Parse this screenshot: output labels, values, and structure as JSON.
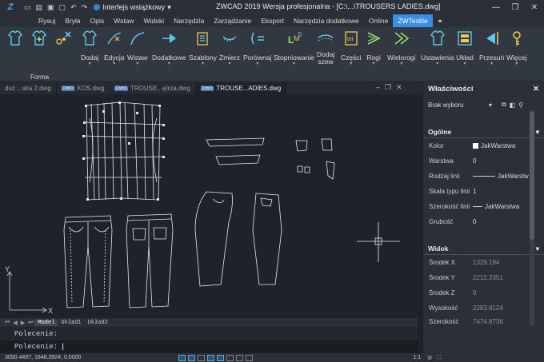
{
  "titlebar": {
    "logo": "Z",
    "workspace": "Interfejs wstążkowy",
    "title": "ZWCAD 2019 Wersja profesjonalna - [C:\\...\\TROUSERS LADIES.dwg]",
    "window_buttons": [
      "—",
      "❐",
      "✕"
    ]
  },
  "menu": {
    "items": [
      "Rysuj",
      "Bryła",
      "Opis",
      "Wstaw",
      "Widoki",
      "Narzędzia",
      "Zarządzanie",
      "Eksport",
      "Narzędzia dodatkowe",
      "Online",
      "ZWTextile"
    ],
    "active": "ZWTextile"
  },
  "ribbon": {
    "panel_label": "Forma",
    "buttons": [
      {
        "label": "Dodaj",
        "icon": "add-icon"
      },
      {
        "label": "Edycja",
        "icon": "edit-icon"
      },
      {
        "label": "Wstaw",
        "icon": "insert-curve-icon"
      },
      {
        "label": "Dodatkowe",
        "icon": "arrow-right-icon"
      },
      {
        "label": "Szablony",
        "icon": "template-icon"
      },
      {
        "label": "Zmierz",
        "icon": "measure-icon"
      },
      {
        "label": "Porównaj",
        "icon": "compare-icon"
      },
      {
        "label": "Stopniowanie",
        "icon": "grading-icon"
      },
      {
        "label": "Dodaj\nszew",
        "icon": "seam-icon"
      },
      {
        "label": "Części",
        "icon": "parts-icon"
      },
      {
        "label": "Rogi",
        "icon": "corners-icon"
      },
      {
        "label": "Wielorogi",
        "icon": "multicorners-icon"
      },
      {
        "label": "Ustawienia",
        "icon": "settings-icon"
      },
      {
        "label": "Układ",
        "icon": "layout-icon"
      },
      {
        "label": "Przesuń",
        "icon": "move-icon"
      },
      {
        "label": "Więcej",
        "icon": "more-icon"
      }
    ]
  },
  "doc_tabs": [
    {
      "label": "duż ...ska 2.dwg",
      "active": false
    },
    {
      "label": "KOS.dwg",
      "active": false
    },
    {
      "label": "TROUSE...ętrza.dwg",
      "active": false
    },
    {
      "label": "TROUSE...ADIES.dwg",
      "active": true
    }
  ],
  "doc_tab_dwg": "DWG",
  "doc_tab_controls": [
    "–",
    "❐",
    "✕"
  ],
  "canvas": {
    "axis_y": "Y",
    "axis_x": "X"
  },
  "layout_tabs": [
    "Model",
    "Układ1",
    "Układ2"
  ],
  "layout_active": "Model",
  "command": {
    "line1": "Polecenie:",
    "line2": "Polecenie:"
  },
  "status": {
    "coords": "3050.4497, 1848.3924, 0.0000",
    "scale": "1:1"
  },
  "properties": {
    "title": "Właściwości",
    "selection": "Brak wyboru",
    "general_header": "Ogólne",
    "general": [
      {
        "key": "Kolor",
        "value": "JakWarstwa",
        "type": "color"
      },
      {
        "key": "Warstwa",
        "value": "0"
      },
      {
        "key": "Rodzaj linii",
        "value": "JakWarstw",
        "type": "line"
      },
      {
        "key": "Skala typu linii",
        "value": "1"
      },
      {
        "key": "Szerokość linii",
        "value": "JakWarstwa",
        "type": "line"
      },
      {
        "key": "Grubość",
        "value": "0"
      }
    ],
    "view_header": "Widok",
    "view": [
      {
        "key": "Środek X",
        "value": "1329.194"
      },
      {
        "key": "Środek Y",
        "value": "2212.2351"
      },
      {
        "key": "Środek Z",
        "value": "0"
      },
      {
        "key": "Wysokość",
        "value": "2283.8124"
      },
      {
        "key": "Szerokość",
        "value": "7474.8736"
      }
    ]
  },
  "colors": {
    "accent": "#3a8ee6",
    "canvas": "#1e232b",
    "panel": "#2b3038"
  }
}
